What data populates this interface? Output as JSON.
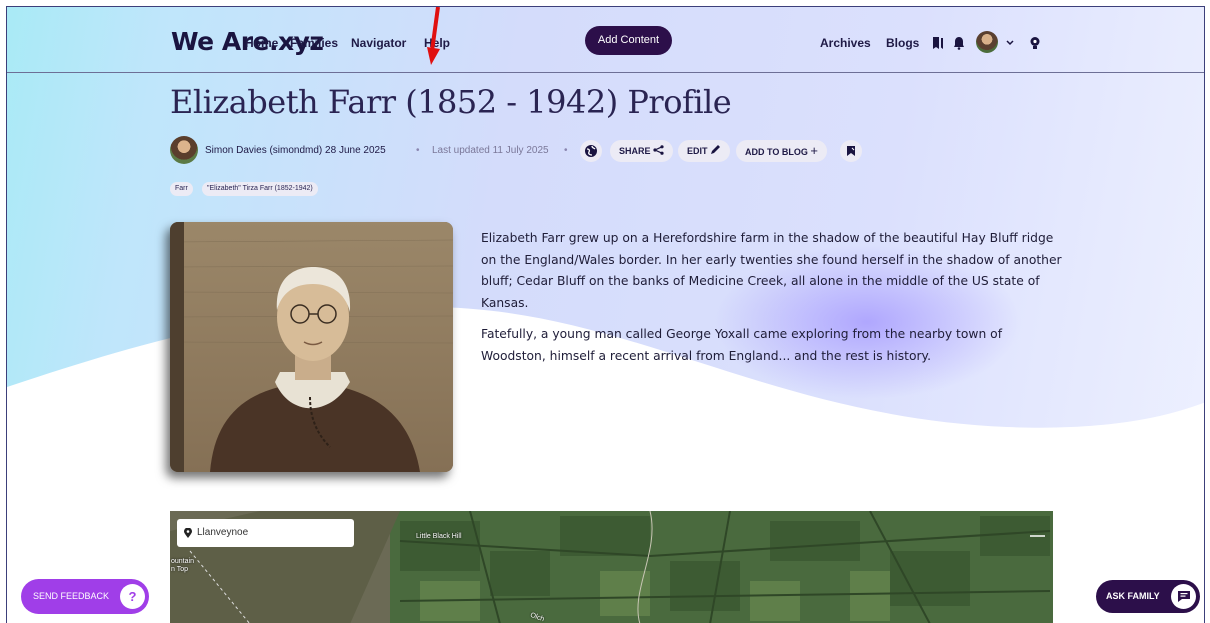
{
  "header": {
    "logo": "We Are.xyz",
    "nav": [
      "Home",
      "Families",
      "Navigator",
      "Help"
    ],
    "add_content": "Add Content",
    "right_links": [
      "Archives",
      "Blogs"
    ]
  },
  "profile": {
    "title": "Elizabeth Farr (1852 - 1942) Profile",
    "author": "Simon Davies (simondmd)",
    "date": "28 June 2025",
    "updated": "Last updated 11 July 2025",
    "actions": {
      "share": "SHARE",
      "edit": "EDIT",
      "add_to_blog": "ADD TO BLOG"
    },
    "tags": [
      "Farr",
      "\"Elizabeth\" Tirza Farr (1852-1942)"
    ]
  },
  "bio": {
    "paragraphs": [
      "Elizabeth Farr grew up on a Herefordshire farm in the shadow of the beautiful Hay Bluff ridge on the England/Wales border. In her early twenties she found herself in the shadow of another bluff; Cedar Bluff on the banks of Medicine Creek, all alone in the middle of the US state of Kansas.",
      "Fatefully, a young man called George Yoxall came exploring from the nearby town of Woodston, himself a recent arrival from England... and the rest is history."
    ]
  },
  "map": {
    "search_value": "Llanveynoe",
    "labels": {
      "hill": "Little Black Hill",
      "mountain_1": "ountain",
      "mountain_2": "n Top",
      "road": "Olch"
    }
  },
  "floating": {
    "feedback": "SEND FEEDBACK",
    "ask_family": "ASK FAMILY"
  },
  "colors": {
    "accent_dark": "#2c0f4a",
    "feedback_purple": "#a03ee8",
    "annotation_red": "#e01010"
  },
  "icons": [
    "bookmarks-icon",
    "bell-icon",
    "avatar",
    "chevron-down-icon",
    "lightbulb-icon",
    "globe-icon",
    "share-icon",
    "pencil-icon",
    "plus-icon",
    "bookmark-icon",
    "pin-icon",
    "question-icon",
    "chat-icon"
  ]
}
